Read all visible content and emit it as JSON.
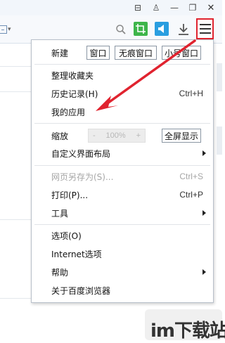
{
  "titlebar": {
    "buttons": [
      {
        "icon": "bag-icon",
        "glyph": "⊟"
      },
      {
        "icon": "shirt-icon",
        "glyph": "♙"
      },
      {
        "icon": "minimize-icon",
        "glyph": "—"
      },
      {
        "icon": "restore-icon",
        "glyph": "❐"
      },
      {
        "icon": "close-icon",
        "glyph": "✕"
      }
    ]
  },
  "colors": {
    "highlight_red": "#e0232f",
    "crop_green": "#3eb54a",
    "share_blue": "#2a9ee0"
  },
  "menu": {
    "new_label": "新建",
    "window_btn": "窗口",
    "incognito_btn": "无痕窗口",
    "small_btn": "小号窗口",
    "organize_favorites": "整理收藏夹",
    "history": "历史记录(H)",
    "history_shortcut": "Ctrl+H",
    "my_apps": "我的应用",
    "zoom_label": "缩放",
    "zoom_minus": "-",
    "zoom_value": "100%",
    "zoom_plus": "+",
    "fullscreen": "全屏显示",
    "customize_layout": "自定义界面布局",
    "save_page_as": "网页另存为(S)...",
    "save_shortcut": "Ctrl+S",
    "print": "打印(P)...",
    "print_shortcut": "Ctrl+P",
    "tools": "工具",
    "options": "选项(O)",
    "internet_options": "Internet选项",
    "help": "帮助",
    "about": "关于百度浏览器"
  },
  "watermark": "im下载站"
}
